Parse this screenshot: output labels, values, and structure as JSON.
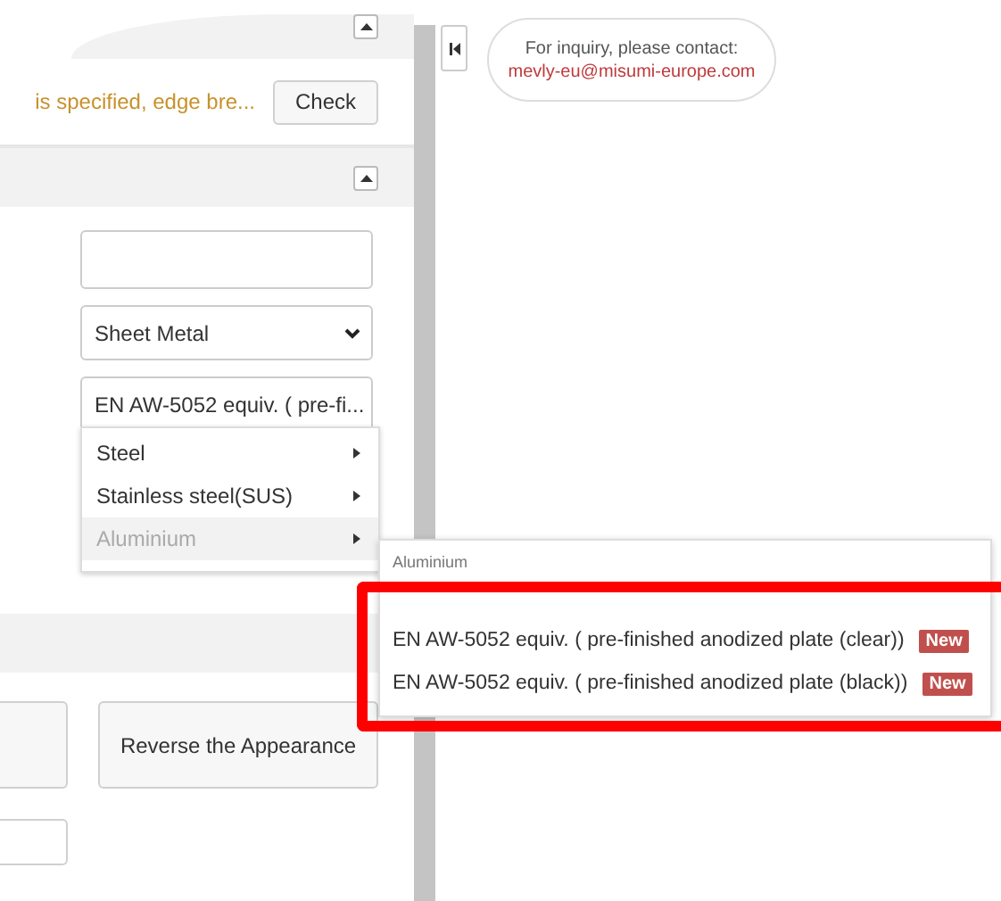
{
  "check_row": {
    "warning": "is specified, edge bre...",
    "button": "Check"
  },
  "selects": [
    "Sheet Metal",
    "EN AW-5052 equiv. ( pre-fi..."
  ],
  "material_menu": [
    {
      "label": "Steel",
      "selected": false
    },
    {
      "label": "Stainless steel(SUS)",
      "selected": false
    },
    {
      "label": "Aluminium",
      "selected": true
    }
  ],
  "submenu": {
    "title": "Aluminium",
    "items": [
      {
        "label": "EN AW-5052 equiv. ( pre-finished anodized plate (clear))",
        "badge": "New"
      },
      {
        "label": "EN AW-5052 equiv. ( pre-finished anodized plate (black))",
        "badge": "New"
      }
    ]
  },
  "buttons": [
    "Reverse the Appearance"
  ],
  "inquiry": {
    "label": "For inquiry, please contact:",
    "email": "mevly-eu@misumi-europe.com"
  }
}
